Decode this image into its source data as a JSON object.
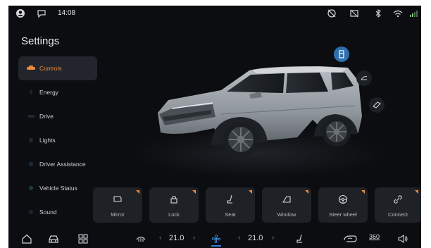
{
  "status_bar": {
    "time": "14:08",
    "left_icons": [
      "user-icon",
      "message-icon"
    ],
    "right_icons": [
      "camera-off-icon",
      "screen-off-icon",
      "bluetooth-icon",
      "wifi-icon",
      "signal-icon"
    ]
  },
  "page": {
    "title": "Settings"
  },
  "sidebar": {
    "items": [
      {
        "label": "Controls",
        "icon": "car-icon",
        "active": true
      },
      {
        "label": "Energy",
        "icon": "energy-icon",
        "active": false
      },
      {
        "label": "Drive",
        "icon": "drive-icon",
        "active": false
      },
      {
        "label": "Lights",
        "icon": "lights-icon",
        "active": false
      },
      {
        "label": "Driver Assistance",
        "icon": "assistance-icon",
        "active": false
      },
      {
        "label": "Vehicle Status",
        "icon": "status-icon",
        "active": false
      },
      {
        "label": "Sound",
        "icon": "sound-icon",
        "active": false
      }
    ]
  },
  "float_buttons": [
    "door-icon",
    "tailgate-icon",
    "sunroof-icon"
  ],
  "controls": {
    "tiles": [
      {
        "label": "Mirror",
        "icon": "mirror-icon"
      },
      {
        "label": "Lock",
        "icon": "lock-icon"
      },
      {
        "label": "Seat",
        "icon": "seat-icon"
      },
      {
        "label": "Window",
        "icon": "window-icon"
      },
      {
        "label": "Steer wheel",
        "icon": "steering-wheel-icon"
      },
      {
        "label": "Connect",
        "icon": "link-icon"
      }
    ]
  },
  "bottom_bar": {
    "left_temp": "21.0",
    "right_temp": "21.0",
    "icons": [
      "home-icon",
      "car-icon",
      "apps-icon",
      "defrost-icon",
      "fan-icon",
      "seat-heat-icon",
      "recirculation-icon",
      "camera-360-icon",
      "volume-icon"
    ],
    "camera_label": "360"
  },
  "colors": {
    "accent": "#f08a3a",
    "active_blue": "#2f6fae",
    "background": "#0b0d10"
  }
}
